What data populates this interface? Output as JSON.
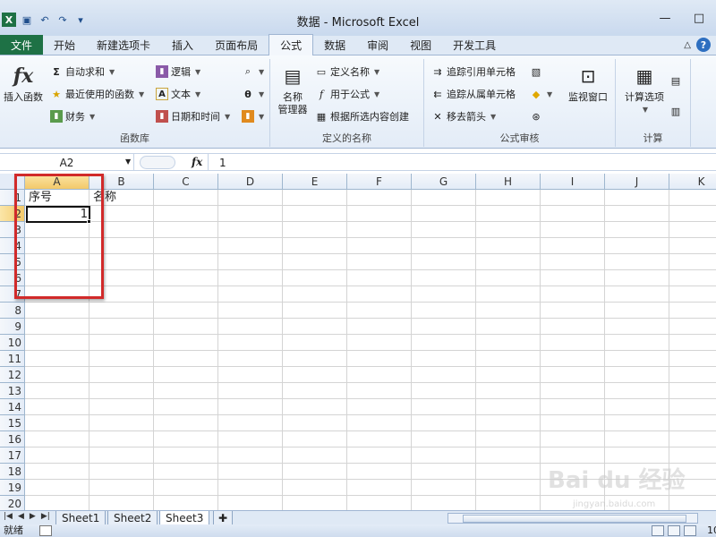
{
  "window": {
    "title": "数据 - Microsoft Excel",
    "controls": [
      "—",
      "□"
    ]
  },
  "qat": {
    "logo": "X",
    "items": [
      "save-icon",
      "undo-icon",
      "redo-icon",
      "customize-icon"
    ]
  },
  "tabs": {
    "file": "文件",
    "items": [
      "开始",
      "新建选项卡",
      "插入",
      "页面布局",
      "公式",
      "数据",
      "审阅",
      "视图",
      "开发工具"
    ],
    "active": "公式",
    "help": "?"
  },
  "ribbon": {
    "function_library": {
      "label": "函数库",
      "insert_function": "插入函数",
      "autosum": "自动求和",
      "recent": "最近使用的函数",
      "financial": "财务",
      "logical": "逻辑",
      "text": "文本",
      "datetime": "日期和时间"
    },
    "defined_names": {
      "label": "定义的名称",
      "name_manager_line1": "名称",
      "name_manager_line2": "管理器",
      "define_name": "定义名称",
      "use_in_formula": "用于公式",
      "create_from_selection": "根据所选内容创建"
    },
    "auditing": {
      "label": "公式审核",
      "trace_precedents": "追踪引用单元格",
      "trace_dependents": "追踪从属单元格",
      "remove_arrows": "移去箭头",
      "watch_window": "监视窗口"
    },
    "calculation": {
      "label": "计算",
      "options": "计算选项"
    }
  },
  "formula_bar": {
    "name_box": "A2",
    "fx": "fx",
    "value": "1"
  },
  "grid": {
    "columns": [
      "A",
      "B",
      "C",
      "D",
      "E",
      "F",
      "G",
      "H",
      "I",
      "J",
      "K"
    ],
    "rows": [
      "1",
      "2",
      "3",
      "4",
      "5",
      "6",
      "7",
      "8",
      "9",
      "10",
      "11",
      "12",
      "13",
      "14",
      "15",
      "16",
      "17",
      "18",
      "19",
      "20"
    ],
    "selected_column": "A",
    "selected_row": "2",
    "cells": {
      "A1": "序号",
      "B1": "名称",
      "A2": "1"
    }
  },
  "sheets": {
    "tabs": [
      "Sheet1",
      "Sheet2",
      "Sheet3"
    ],
    "active": "Sheet3"
  },
  "status": {
    "ready": "就绪",
    "zoom": "10"
  },
  "watermark": {
    "main": "Bai du 经验",
    "sub": "jingyan.baidu.com"
  }
}
